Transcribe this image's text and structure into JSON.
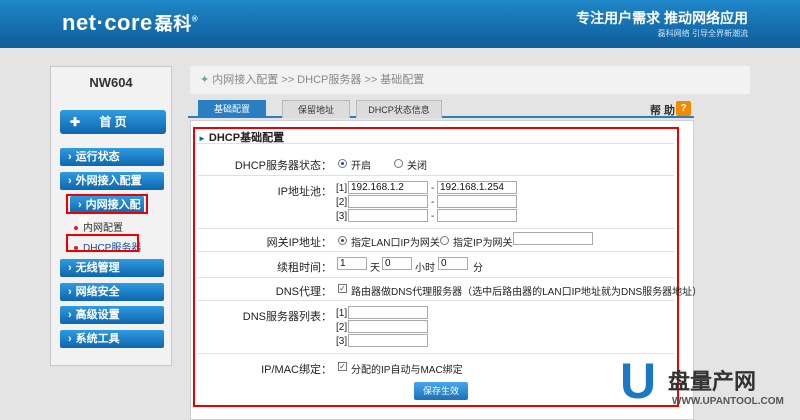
{
  "header": {
    "logo_en": "net·core",
    "logo_cn": "磊科",
    "logo_mark": "®",
    "slogan": "专注用户需求   推动网络应用",
    "slogan_sub": "磊科网络 引导全界新潮流"
  },
  "sidebar": {
    "model": "NW604",
    "home": "首  页",
    "items": [
      {
        "label": "运行状态"
      },
      {
        "label": "外网接入配置"
      },
      {
        "label": "内网接入配置"
      },
      {
        "label": "无线管理"
      },
      {
        "label": "网络安全"
      },
      {
        "label": "高级设置"
      },
      {
        "label": "系统工具"
      }
    ],
    "subitems": [
      {
        "label": "内网配置"
      },
      {
        "label": "DHCP服务器"
      }
    ]
  },
  "breadcrumb": "内网接入配置 >> DHCP服务器 >> 基础配置",
  "tabs": [
    {
      "label": "基础配置",
      "active": true
    },
    {
      "label": "保留地址",
      "active": false
    },
    {
      "label": "DHCP状态信息",
      "active": false
    }
  ],
  "help": {
    "label": "帮 助",
    "icon": "?"
  },
  "panel": {
    "title": "DHCP基础配置",
    "server_status": {
      "label": "DHCP服务器状态：",
      "on": "开启",
      "off": "关闭"
    },
    "ip_pool": {
      "label": "IP地址池：",
      "rows": [
        {
          "index": "[1]",
          "start": "192.168.1.2",
          "end": "192.168.1.254"
        },
        {
          "index": "[2]",
          "start": "",
          "end": ""
        },
        {
          "index": "[3]",
          "start": "",
          "end": ""
        }
      ],
      "dash": "-"
    },
    "gateway": {
      "label": "网关IP地址：",
      "opt1": "指定LAN口IP为网关",
      "opt2": "指定IP为网关",
      "value": ""
    },
    "lease": {
      "label": "续租时间：",
      "days": "1",
      "days_unit": "天",
      "hours": "0",
      "hours_unit": "小时",
      "minutes": "0",
      "minutes_unit": "分"
    },
    "dns_proxy": {
      "label": "DNS代理：",
      "text": "路由器做DNS代理服务器（选中后路由器的LAN口IP地址就为DNS服务器地址）"
    },
    "dns_list": {
      "label": "DNS服务器列表：",
      "rows": [
        {
          "index": "[1]",
          "value": ""
        },
        {
          "index": "[2]",
          "value": ""
        },
        {
          "index": "[3]",
          "value": ""
        }
      ]
    },
    "ipmac": {
      "label": "IP/MAC绑定：",
      "text": "分配的IP自动与MAC绑定"
    },
    "save": "保存生效"
  },
  "watermark": {
    "letter": "U",
    "text": "盘量产网",
    "url": "WWW.UPANTOOL.COM"
  }
}
